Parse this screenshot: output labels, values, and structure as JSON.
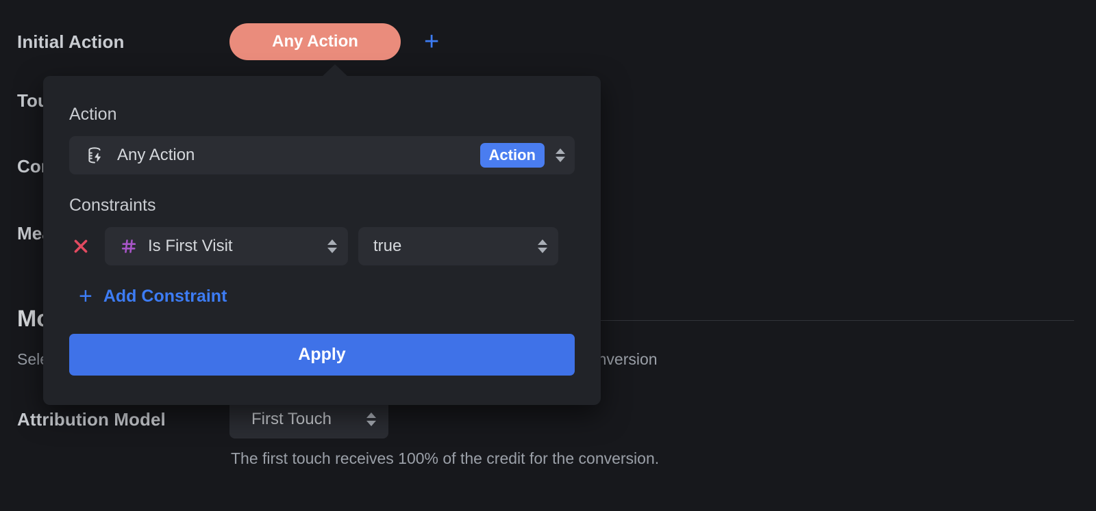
{
  "background": {
    "initial_action": {
      "label": "Initial Action",
      "pill_label": "Any Action",
      "add_icon": "plus-icon"
    },
    "rows": [
      {
        "label": "Touchpoints"
      },
      {
        "label": "Conversion"
      },
      {
        "label": "Measurement Window"
      }
    ],
    "section": {
      "heading": "Model",
      "subtitle": "Select how credit is distributed across each touchpoint experience relative to the conversion"
    },
    "attribution": {
      "label": "Attribution Model",
      "selected": "First Touch",
      "helper": "The first touch receives 100% of the credit for the conversion."
    }
  },
  "popover": {
    "action_section_label": "Action",
    "action": {
      "icon": "action-bolt-icon",
      "name": "Any Action",
      "badge": "Action"
    },
    "constraints_label": "Constraints",
    "constraints": [
      {
        "remove_icon": "close-icon",
        "field_icon": "hash-icon",
        "field": "Is First Visit",
        "value": "true"
      }
    ],
    "add_constraint": {
      "icon": "plus-icon",
      "label": "Add Constraint"
    },
    "apply_label": "Apply"
  },
  "colors": {
    "page_bg": "#17181c",
    "popover_bg": "#212328",
    "field_bg": "#2b2d33",
    "accent_blue": "#3f72e8",
    "badge_blue": "#4a7df0",
    "link_blue": "#3d7cf4",
    "pill_salmon": "#ea8c7c",
    "hash_purple": "#a855c8",
    "remove_red": "#e24a60",
    "text_primary": "#d8dadd",
    "text_muted": "#9ba0a8"
  }
}
